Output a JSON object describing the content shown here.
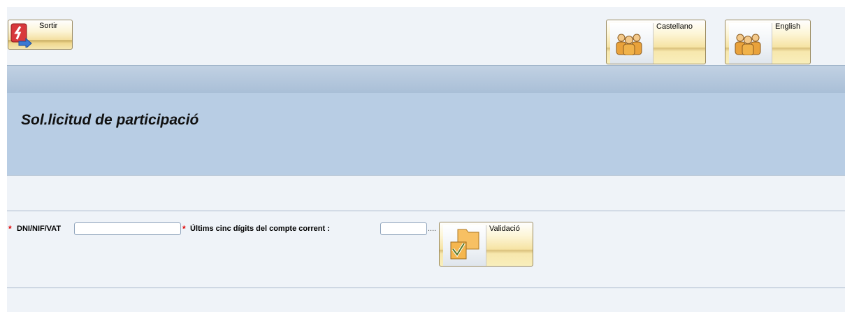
{
  "header": {
    "exit_label": "Sortir",
    "lang_castellano": "Castellano",
    "lang_english": "English"
  },
  "page": {
    "title": "Sol.licitud de participació"
  },
  "form": {
    "required_mark": "*",
    "dni_label": "DNI/NIF/VAT",
    "dni_value": "",
    "account_label": "Últims cinc dígits del compte corrent :",
    "account_value": "",
    "dots": "....",
    "validate_label": "Validació"
  },
  "colors": {
    "band": "#b8cde4",
    "required": "#e00000",
    "button_gold": "#f6e3a3"
  }
}
